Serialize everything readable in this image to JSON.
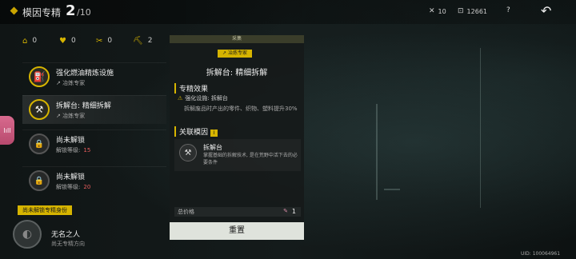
{
  "header": {
    "title": "模因专精",
    "count_current": "2",
    "count_total": "/10",
    "resources": [
      {
        "icon": "cross-swords-icon",
        "value": "10"
      },
      {
        "icon": "box-icon",
        "value": "12661"
      }
    ],
    "help_label": "?",
    "back_icon": "back-arrow-icon"
  },
  "stats": [
    {
      "icon": "home-icon",
      "value": "0"
    },
    {
      "icon": "heart-icon",
      "value": "0"
    },
    {
      "icon": "crossed-tools-icon",
      "value": "0"
    },
    {
      "icon": "pickaxe-icon",
      "value": "2"
    }
  ],
  "skills": [
    {
      "title": "强化燃油精炼设施",
      "sub": "冶炼专家",
      "active": false,
      "locked": false
    },
    {
      "title": "拆解台: 精细拆解",
      "sub": "冶炼专家",
      "active": true,
      "locked": false
    },
    {
      "title": "尚未解锁",
      "sub": "解锁等级:",
      "level": "15",
      "locked": true
    },
    {
      "title": "尚未解锁",
      "sub": "解锁等级:",
      "level": "20",
      "locked": true
    }
  ],
  "side_tab": {
    "label": "lıll"
  },
  "profile": {
    "banner": "尚未解锁专精身份",
    "name": "无名之人",
    "sub": "尚无专精方向"
  },
  "detail": {
    "header": "采集",
    "role_badge": "冶炼专家",
    "title": "拆解台: 精细拆解",
    "effect_label": "专精效果",
    "effect_target": "强化设施: 拆解台",
    "effect_desc": "拆解废品时产出的零件、织物、塑料提升30%",
    "related_label": "关联模因",
    "gene": {
      "title": "拆解台",
      "desc": "掌握基础的拆解技术, 是在荒野中活下去的必要条件"
    },
    "price_label": "总价格",
    "price_value": "1",
    "reset_label": "重置"
  },
  "uid": "UID: 100064961",
  "colors": {
    "accent": "#d6b400",
    "locked_level": "#e85d5d",
    "button_bg": "#dfe3dc"
  }
}
